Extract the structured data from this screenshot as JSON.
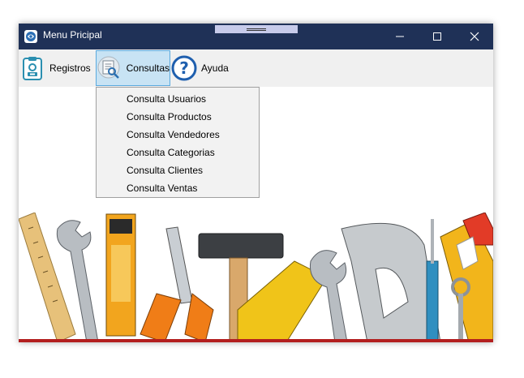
{
  "window": {
    "title": "Menu Pricipal",
    "controls": {
      "minimize_icon": "minimize-icon",
      "maximize_icon": "maximize-icon",
      "close_icon": "close-icon"
    }
  },
  "menubar": {
    "items": [
      {
        "label": "Registros",
        "icon": "clipboard-id-icon"
      },
      {
        "label": "Consultas",
        "icon": "document-search-icon",
        "active": true
      },
      {
        "label": "Ayuda",
        "icon": "help-icon"
      }
    ]
  },
  "dropdown": {
    "items": [
      "Consulta Usuarios",
      "Consulta Productos",
      "Consulta Vendedores",
      "Consulta Categorias",
      "Consulta Clientes",
      "Consulta Ventas"
    ]
  },
  "colors": {
    "titlebar": "#1f3157",
    "menubar": "#f0f0f0",
    "active_menu_bg": "#c8e3f4",
    "active_menu_border": "#5aa9de",
    "dropdown_bg": "#f2f2f2",
    "accent_red": "#b31f1f"
  }
}
